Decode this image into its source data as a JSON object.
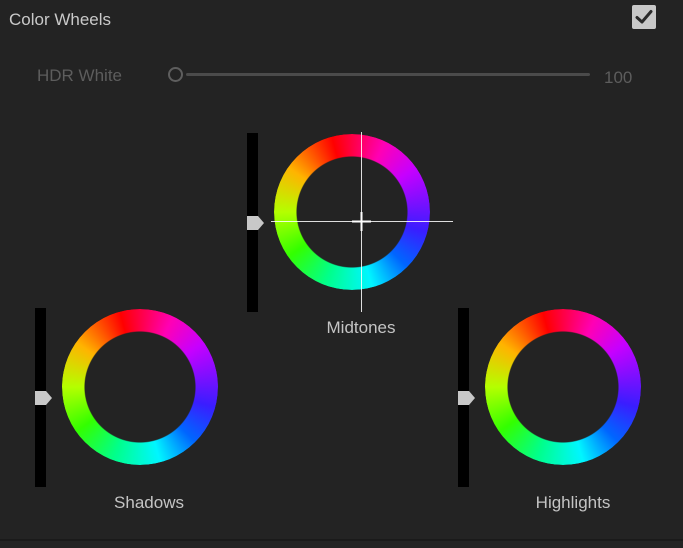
{
  "panel": {
    "title": "Color Wheels",
    "enabled": true,
    "checkbox_icon": "checkmark-icon"
  },
  "hdr_white": {
    "label": "HDR White",
    "value": "100"
  },
  "wheels": {
    "midtones": {
      "label": "Midtones",
      "luminance_level": 0.5
    },
    "shadows": {
      "label": "Shadows",
      "luminance_level": 0.5
    },
    "highlights": {
      "label": "Highlights",
      "luminance_level": 0.5
    }
  },
  "colors": {
    "background": "#232323",
    "text": "#c9c9c9",
    "disabled_text": "#5d5d5d",
    "slider_track": "#000000",
    "handle": "#c8c8c8"
  }
}
